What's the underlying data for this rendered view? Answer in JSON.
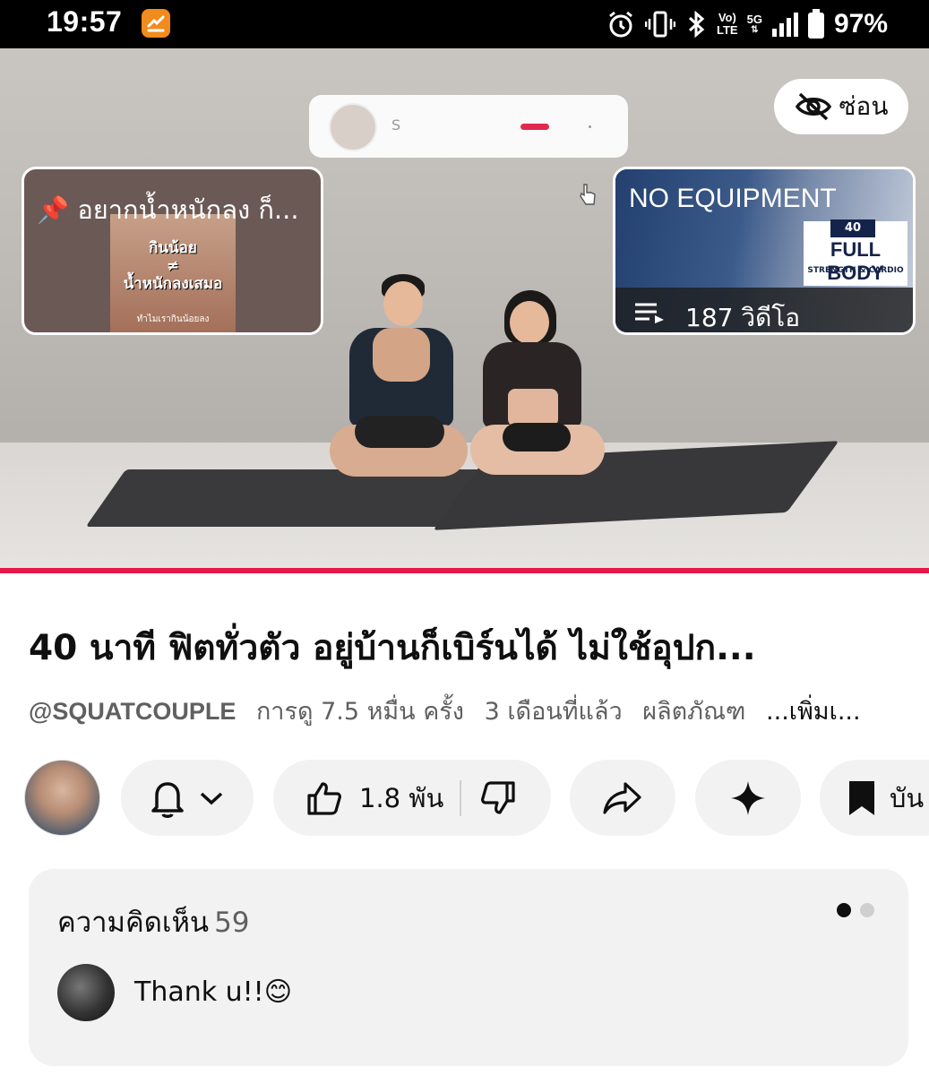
{
  "status_bar": {
    "time": "19:57",
    "network_top": "Vo)",
    "network_bottom": "LTE",
    "signal_label": "5G",
    "battery_percent": "97%",
    "icons": [
      "alarm-icon",
      "vibrate-icon",
      "bluetooth-icon",
      "signal-icon",
      "battery-icon"
    ]
  },
  "video": {
    "hide_label": "ซ่อน",
    "channel_card_name": "S",
    "card_left": {
      "title": "อยากน้ำหนักลง ก็...",
      "thumb_line1": "กินน้อย",
      "thumb_line2": "≠",
      "thumb_line3": "น้ำหนักลงเสมอ",
      "thumb_caption": "ทำไมเรากินน้อยลง"
    },
    "card_right": {
      "title": "NO EQUIPMENT",
      "badge_min": "40 MIN",
      "badge_main": "FULL BODY",
      "badge_sub": "STRENGTH & CARDIO",
      "video_count": "187 วิดีโอ"
    },
    "progress_color": "#e5194a"
  },
  "details": {
    "title": "40 นาที ฟิตทั่วตัว อยู่บ้านก็เบิร์นได้ ไม่ใช้อุปก...",
    "channel_handle": "@SQUATCOUPLE",
    "views": "การดู 7.5 หมื่น ครั้ง",
    "age": "3 เดือนที่แล้ว",
    "products": "ผลิตภัณฑ",
    "more": "...เพิ่มเ..."
  },
  "actions": {
    "likes": "1.8 พัน",
    "save_label": "บัน"
  },
  "comments": {
    "heading": "ความคิดเห็น",
    "count": "59",
    "first_comment": "Thank u!!😊",
    "dot_active_color": "#0f0f0f",
    "dot_inactive_color": "#cfcfcf"
  }
}
